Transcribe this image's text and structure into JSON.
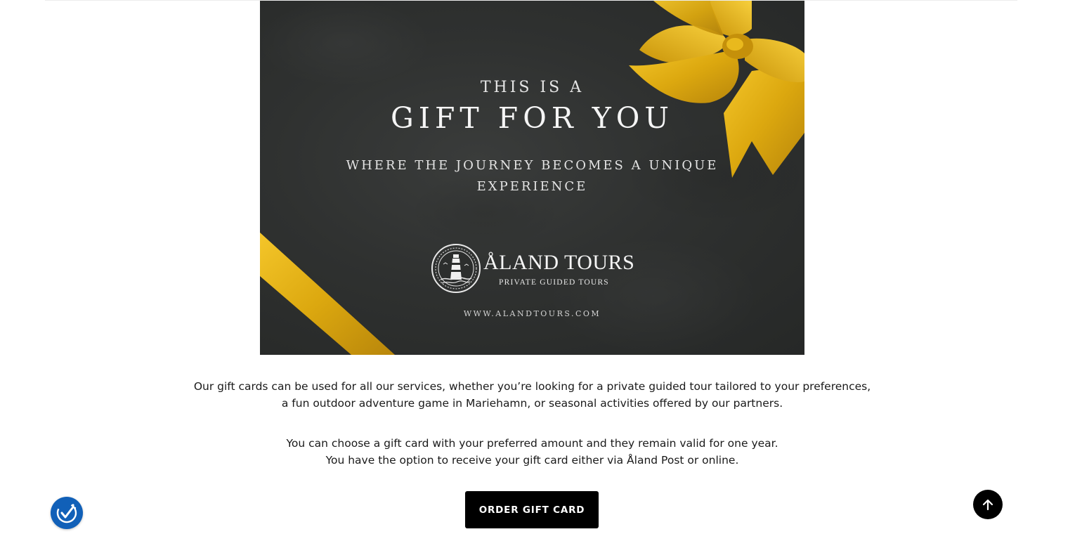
{
  "gift_card": {
    "pretitle": "THIS IS A",
    "title": "GIFT FOR YOU",
    "subtitle": "WHERE THE JOURNEY BECOMES A UNIQUE EXPERIENCE",
    "brand": "ÅLAND TOURS",
    "tagline": "PRIVATE GUIDED TOURS",
    "url": "WWW.ALANDTOURS.COM",
    "colors": {
      "background": "#2f3130",
      "ribbon": "#e2ad12",
      "text": "#f2f2f2"
    }
  },
  "description": {
    "paragraph_1": {
      "line_1": "Our gift cards can be used for all our services, whether you’re looking for a private guided tour tailored to your preferences,",
      "line_2": "a fun outdoor adventure game in Mariehamn, or seasonal activities offered by our partners."
    },
    "paragraph_2": {
      "line_1": "You can choose a gift card with your preferred amount and they remain valid for one year.",
      "line_2": "You have the option to receive your gift card either via Åland Post or online."
    }
  },
  "cta": {
    "order_label": "ORDER GIFT CARD"
  },
  "widgets": {
    "accessibility_icon": "accessibility-check-icon",
    "back_to_top_icon": "arrow-up-icon",
    "accessibility_color": "#1160b8"
  }
}
